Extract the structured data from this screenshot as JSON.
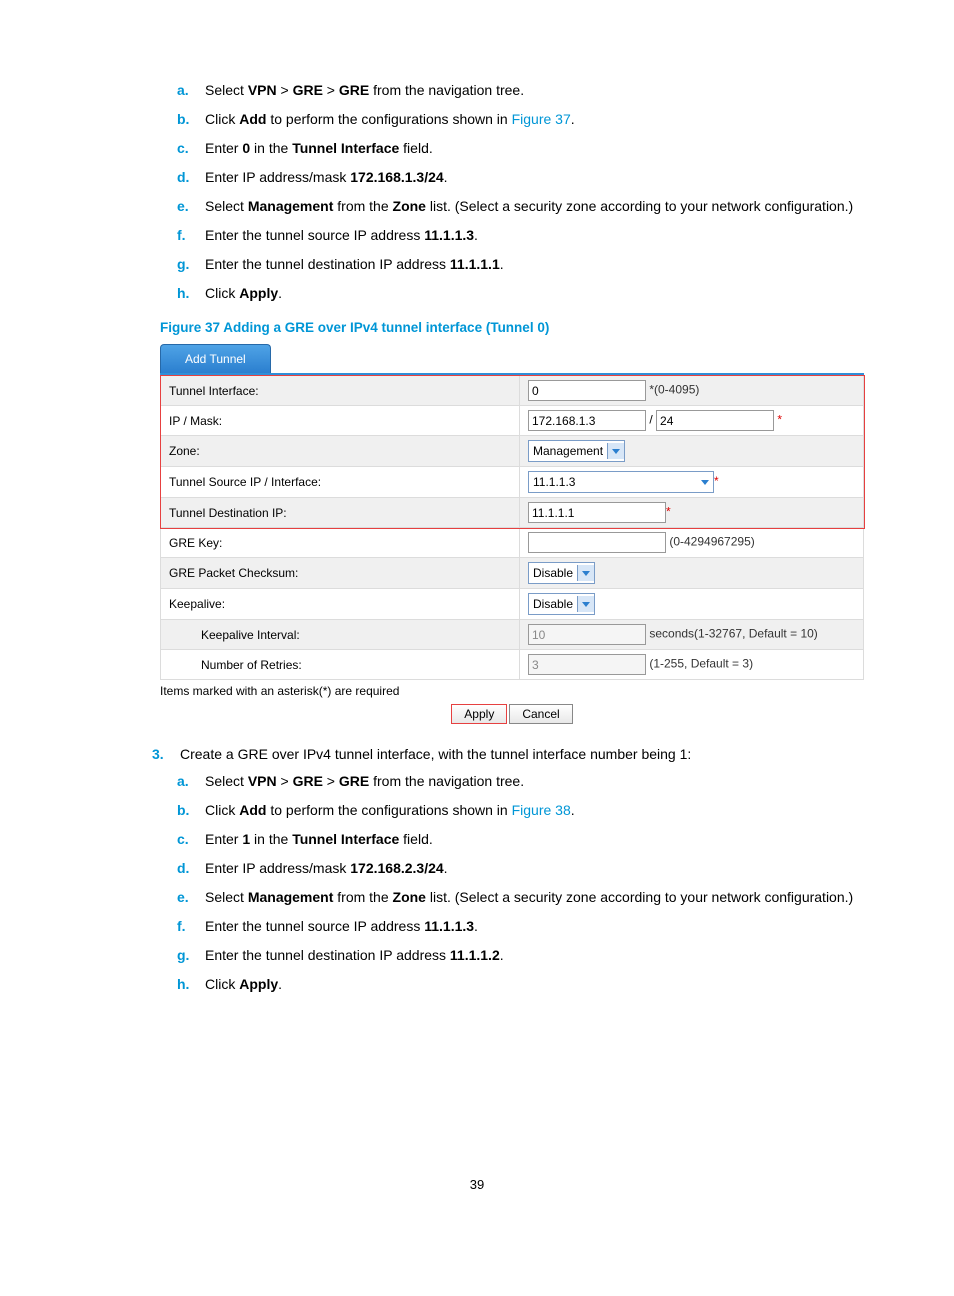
{
  "list1": {
    "a1": "Select ",
    "a2": "VPN",
    "a3": " > ",
    "a4": "GRE",
    "a5": " > ",
    "a6": "GRE",
    "a7": " from the navigation tree.",
    "b1": "Click ",
    "b2": "Add",
    "b3": " to perform the configurations shown in ",
    "b4": "Figure 37",
    "b5": ".",
    "c1": "Enter ",
    "c2": "0",
    "c3": " in the ",
    "c4": "Tunnel Interface",
    "c5": " field.",
    "d1": "Enter IP address/mask ",
    "d2": "172.168.1.3/24",
    "d3": ".",
    "e1": "Select ",
    "e2": "Management",
    "e3": " from the ",
    "e4": "Zone",
    "e5": " list. (Select a security zone according to your network configuration.)",
    "f1": "Enter the tunnel source IP address ",
    "f2": "11.1.1.3",
    "f3": ".",
    "g1": "Enter the tunnel destination IP address ",
    "g2": "11.1.1.1",
    "g3": ".",
    "h1": "Click ",
    "h2": "Apply",
    "h3": "."
  },
  "markers": {
    "a": "a.",
    "b": "b.",
    "c": "c.",
    "d": "d.",
    "e": "e.",
    "f": "f.",
    "g": "g.",
    "h": "h.",
    "n3": "3."
  },
  "figureTitle": "Figure 37 Adding a GRE over IPv4 tunnel interface (Tunnel 0)",
  "fig": {
    "tab": "Add Tunnel",
    "rows": {
      "tunIf": {
        "label": "Tunnel Interface:",
        "value": "0",
        "hint": "*(0-4095)"
      },
      "ipMask": {
        "label": "IP / Mask:",
        "ip": "172.168.1.3",
        "sep": "/",
        "mask": "24",
        "star": "*"
      },
      "zone": {
        "label": "Zone:",
        "value": "Management"
      },
      "src": {
        "label": "Tunnel Source IP / Interface:",
        "value": "11.1.1.3",
        "star": "*"
      },
      "dst": {
        "label": "Tunnel Destination IP:",
        "value": "11.1.1.1",
        "star": "*"
      },
      "greKey": {
        "label": "GRE Key:",
        "value": "",
        "hint": "(0-4294967295)"
      },
      "chk": {
        "label": "GRE Packet Checksum:",
        "value": "Disable"
      },
      "keep": {
        "label": "Keepalive:",
        "value": "Disable"
      },
      "keepInt": {
        "label": "Keepalive Interval:",
        "value": "10",
        "hint": "seconds(1-32767, Default = 10)"
      },
      "retries": {
        "label": "Number of Retries:",
        "value": "3",
        "hint": "(1-255, Default = 3)"
      }
    },
    "note": "Items marked with an asterisk(*) are required",
    "apply": "Apply",
    "cancel": "Cancel"
  },
  "step3": "Create a GRE over IPv4 tunnel interface, with the tunnel interface number being 1:",
  "list2": {
    "a1": "Select ",
    "a2": "VPN",
    "a3": " > ",
    "a4": "GRE",
    "a5": " > ",
    "a6": "GRE",
    "a7": " from the navigation tree.",
    "b1": "Click ",
    "b2": "Add",
    "b3": " to perform the configurations shown in ",
    "b4": "Figure 38",
    "b5": ".",
    "c1": "Enter ",
    "c2": "1",
    "c3": " in the ",
    "c4": "Tunnel Interface",
    "c5": " field.",
    "d1": "Enter IP address/mask ",
    "d2": "172.168.2.3/24",
    "d3": ".",
    "e1": "Select ",
    "e2": "Management",
    "e3": " from the ",
    "e4": "Zone",
    "e5": " list. (Select a security zone according to your network configuration.)",
    "f1": "Enter the tunnel source IP address ",
    "f2": "11.1.1.3",
    "f3": ".",
    "g1": "Enter the tunnel destination IP address ",
    "g2": "11.1.1.2",
    "g3": ".",
    "h1": "Click ",
    "h2": "Apply",
    "h3": "."
  },
  "pageNum": "39"
}
